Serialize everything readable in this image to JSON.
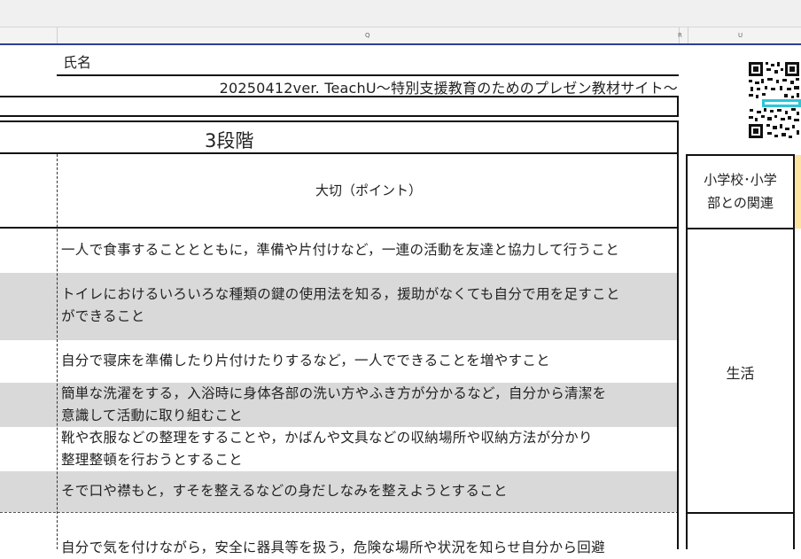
{
  "header": {
    "column_letters": [
      "Q",
      "R",
      "U"
    ]
  },
  "sheet": {
    "name_label": "氏名",
    "version_text": "20250412ver. TeachU～特別支援教育のためのプレゼン教材サイト～",
    "stage_title": "3段階",
    "point_header": "大切（ポイント）",
    "relation_header_line1": "小学校･小学",
    "relation_header_line2": "部との関連",
    "relation_value": "生活",
    "rows": [
      {
        "lines": [
          "一人で食事することとともに，準備や片付けなど，一連の活動を友達と協力して行うこと"
        ],
        "shaded": false
      },
      {
        "lines": [
          "トイレにおけるいろいろな種類の鍵の使用法を知る，援助がなくても自分で用を足すこと",
          "ができること"
        ],
        "shaded": true
      },
      {
        "lines": [
          "自分で寝床を準備したり片付けたりするなど，一人でできることを増やすこと"
        ],
        "shaded": false
      },
      {
        "lines": [
          "簡単な洗濯をする，入浴時に身体各部の洗い方やふき方が分かるなど，自分から清潔を",
          "意識して活動に取り組むこと"
        ],
        "shaded": true
      },
      {
        "lines": [
          "靴や衣服などの整理をすることや，かばんや文具などの収納場所や収納方法が分かり",
          "整理整頓を行おうとすること"
        ],
        "shaded": false
      },
      {
        "lines": [
          "そで口や襟もと，すそを整えるなどの身だしなみを整えようとすること"
        ],
        "shaded": true
      },
      {
        "lines": [
          "自分で気を付けながら，安全に器具等を扱う，危険な場所や状況を知らせ自分から回避"
        ],
        "shaded": false
      }
    ]
  },
  "colors": {
    "row_shade": "#d9d9d9",
    "header_accent": "#2f3f8f",
    "yellow_cell": "#fce4a0"
  },
  "icons": {
    "qr": "qr-code-icon"
  }
}
